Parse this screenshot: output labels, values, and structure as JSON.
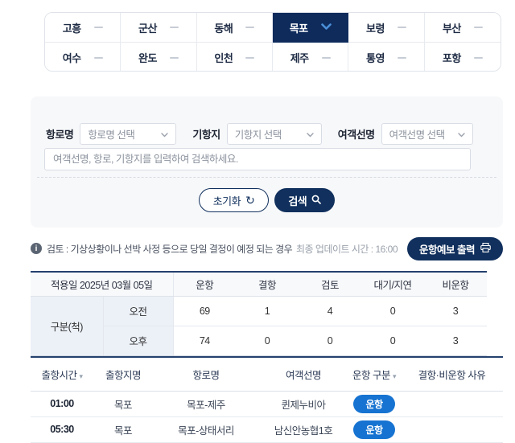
{
  "ports": {
    "selected": "목포",
    "rows": [
      [
        {
          "label": "고흥"
        },
        {
          "label": "군산"
        },
        {
          "label": "동해"
        },
        {
          "label": "목포"
        },
        {
          "label": "보령"
        },
        {
          "label": "부산"
        }
      ],
      [
        {
          "label": "여수"
        },
        {
          "label": "완도"
        },
        {
          "label": "인천"
        },
        {
          "label": "제주"
        },
        {
          "label": "통영"
        },
        {
          "label": "포항"
        }
      ]
    ]
  },
  "filters": {
    "route_label": "항로명",
    "route_value": "항로명 선택",
    "call_label": "기항지",
    "call_value": "기항지 선택",
    "ship_label": "여객선명",
    "ship_value": "여객선명 선택",
    "search_placeholder": "여객선명, 항로, 기항지를 입력하여 검색하세요.",
    "reset_label": "초기화",
    "search_label": "검색"
  },
  "notice": {
    "review_note": "검토 : 기상상황이나 선박 사정 등으로 당일 결정이 예정 되는 경우",
    "last_update": "최종 업데이트 시간 : 16:00",
    "print_label": "운항예보 출력"
  },
  "summary": {
    "date_header": "적용일 2025년 03월 05일",
    "columns": [
      "운항",
      "결항",
      "검토",
      "대기/지연",
      "비운항"
    ],
    "group_label": "구분(척)",
    "rows": [
      {
        "label": "오전",
        "values": [
          "69",
          "1",
          "4",
          "0",
          "3"
        ]
      },
      {
        "label": "오후",
        "values": [
          "74",
          "0",
          "0",
          "0",
          "3"
        ]
      }
    ]
  },
  "schedule": {
    "headers": [
      "출항시간",
      "출항지명",
      "항로명",
      "여객선명",
      "운항 구분",
      "결항·비운항 사유"
    ],
    "rows": [
      {
        "time": "01:00",
        "origin": "목포",
        "route": "목포-제주",
        "ship": "퀸제누비아",
        "status": "운항",
        "reason": ""
      },
      {
        "time": "05:30",
        "origin": "목포",
        "route": "목포-상태서리",
        "ship": "남신안농협1호",
        "status": "운항",
        "reason": ""
      }
    ]
  },
  "colors": {
    "navy": "#11305d",
    "selected_cell": "#0e2b5c",
    "badge_blue": "#1673d1",
    "chevron_blue": "#4a8fd8",
    "panel_bg": "#f7f8fa"
  }
}
